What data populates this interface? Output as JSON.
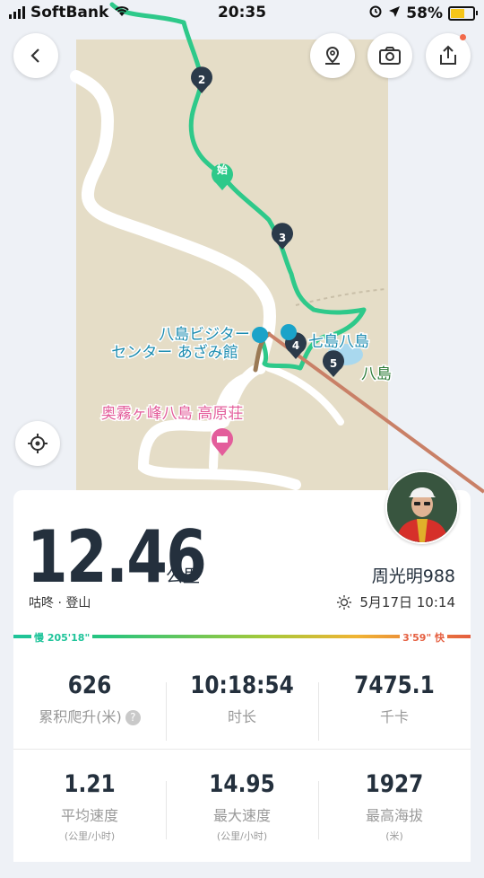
{
  "status_bar": {
    "carrier": "SoftBank",
    "time": "20:35",
    "battery": "58%"
  },
  "map": {
    "labels": {
      "visitor_center_line1": "八島ビジター",
      "visitor_center_line2": "センター あざみ館",
      "yashima_pond": "七島八島",
      "yashima_side": "八島",
      "lodge": "奥霧ヶ峰八島 高原荘"
    },
    "markers": [
      "2",
      "3",
      "4",
      "5"
    ],
    "start_marker": "始",
    "route_color": "#2ec98a"
  },
  "activity": {
    "distance": "12.46",
    "distance_unit": "公里",
    "sport": "咕咚 · 登山",
    "user": "周光明988",
    "date_time": "5月17日 10:14"
  },
  "pace": {
    "slow_label": "慢 205'18\"",
    "fast_label": "3'59\" 快"
  },
  "stats": [
    {
      "value": "626",
      "label": "累积爬升(米)",
      "sub": ""
    },
    {
      "value": "10:18:54",
      "label": "时长",
      "sub": ""
    },
    {
      "value": "7475.1",
      "label": "千卡",
      "sub": ""
    },
    {
      "value": "1.21",
      "label": "平均速度",
      "sub": "(公里/小时)"
    },
    {
      "value": "14.95",
      "label": "最大速度",
      "sub": "(公里/小时)"
    },
    {
      "value": "1927",
      "label": "最高海拔",
      "sub": "(米)"
    }
  ]
}
